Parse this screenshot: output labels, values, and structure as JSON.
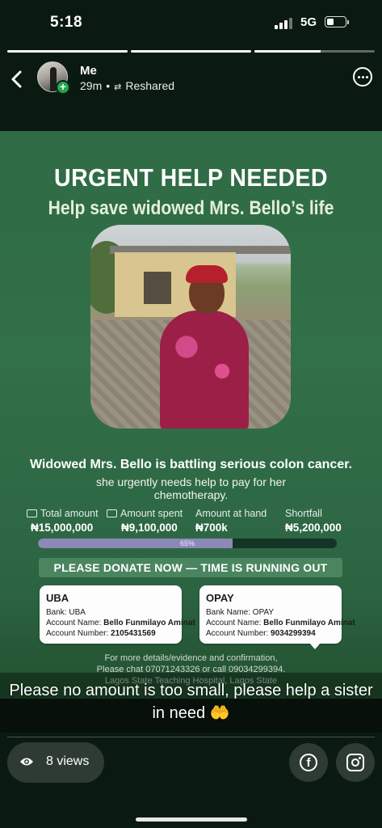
{
  "status_bar": {
    "time": "5:18",
    "network": "5G",
    "battery_level": 0.4
  },
  "story_progress": [
    1.0,
    1.0,
    0.55
  ],
  "header": {
    "user_name": "Me",
    "time_ago": "29m",
    "separator": "•",
    "reshare_label": "Reshared"
  },
  "flyer": {
    "title": "URGENT HELP NEEDED",
    "subtitle": "Help save widowed Mrs. Bello’s life",
    "headline": "Widowed Mrs. Bello is battling serious colon cancer.",
    "subline": "she urgently needs help to pay for her chemotherapy.",
    "stats": {
      "total_label": "Total amount",
      "total_value": "₦15,000,000",
      "spent_label": "Amount spent",
      "spent_value": "₦9,100,000",
      "at_hand_label": "Amount at hand",
      "at_hand_value": "₦700k",
      "shortfall_label": "Shortfall",
      "shortfall_value": "₦5,200,000"
    },
    "progress_label": "65%",
    "progress_fraction": 0.65,
    "cta": "PLEASE DONATE NOW — TIME IS RUNNING OUT",
    "banks": [
      {
        "title": "UBA",
        "bank_line": "Bank: UBA",
        "account_name_label": "Account Name: ",
        "account_name": "Bello Funmilayo Aminat",
        "account_number_label": "Account Number: ",
        "account_number": "2105431569"
      },
      {
        "title": "OPAY",
        "bank_line": "Bank Name: OPAY",
        "account_name_label": "Account Name: ",
        "account_name": "Bello Funmilayo Aminat",
        "account_number_label": "Account Number: ",
        "account_number": "9034299394"
      }
    ],
    "contact_line1": "For more details/evidence and confirmation,",
    "contact_line2": "Please chat 07071243326 or call 09034299394.",
    "hospital": "Lagos State Teaching Hospital, Lagos State"
  },
  "caption": "Please no amount is too small, please help a sister in need 🤲",
  "footer": {
    "views": "8 views"
  },
  "colors": {
    "flyer_green": "#2f6b45",
    "progress_bar": "#8b89b6",
    "badge_green": "#1fa64a"
  }
}
